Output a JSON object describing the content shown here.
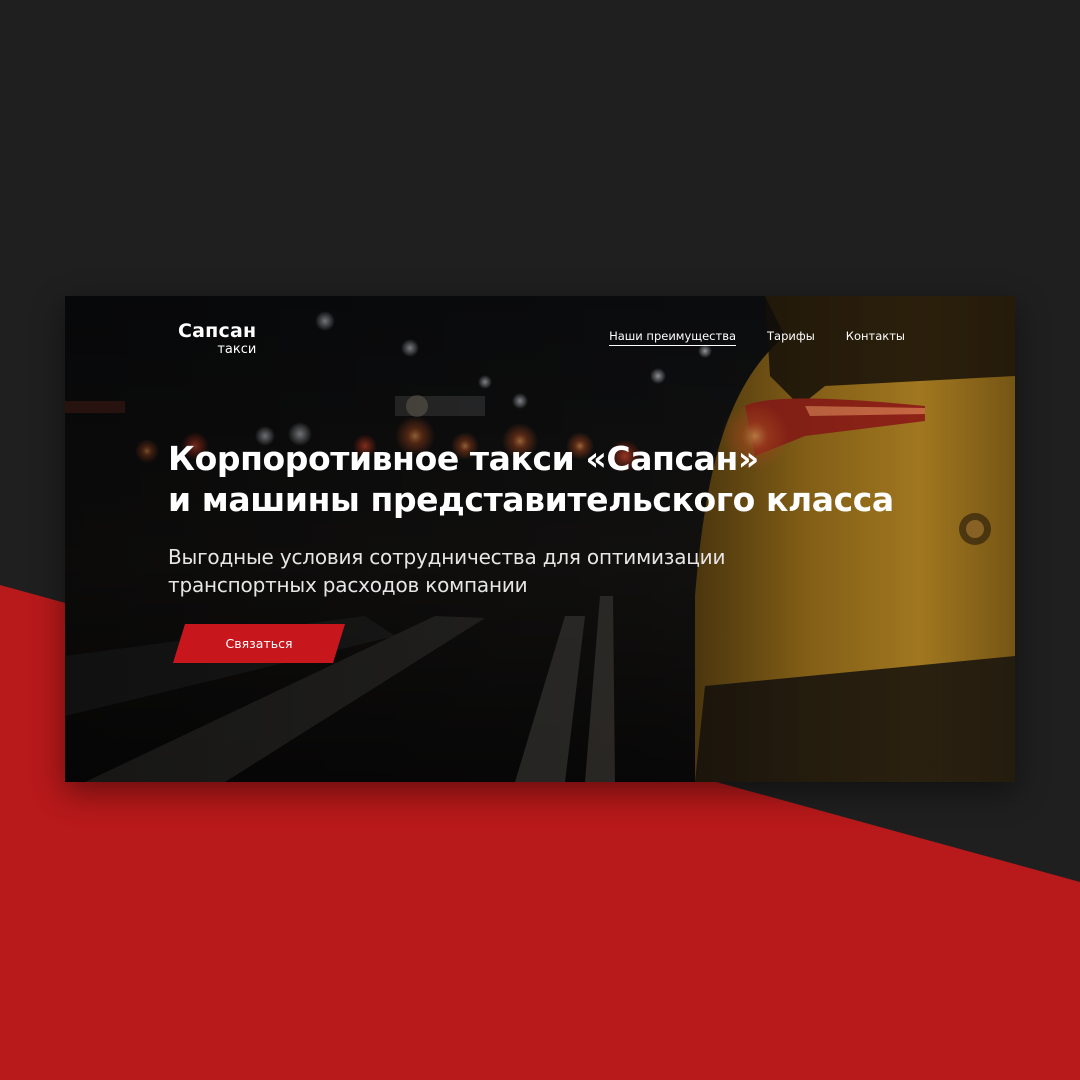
{
  "logo": {
    "name": "Сапсан",
    "sub": "такси"
  },
  "nav": {
    "items": [
      {
        "label": "Наши преимущества",
        "active": true
      },
      {
        "label": "Тарифы",
        "active": false
      },
      {
        "label": "Контакты",
        "active": false
      }
    ]
  },
  "hero": {
    "headline_line1": "Корпоротивное такси «Сапсан»",
    "headline_line2": "и машины представительского класса",
    "sub_line1": "Выгодные условия сотрудничества для оптимизации",
    "sub_line2": "транспортных расходов компании",
    "cta_label": "Связаться",
    "background_icon": "night-street-taxi-photo"
  },
  "colors": {
    "backdrop": "#1f1f1f",
    "accent_red": "#b8191a",
    "button_red": "#c8161d",
    "text": "#ffffff"
  }
}
